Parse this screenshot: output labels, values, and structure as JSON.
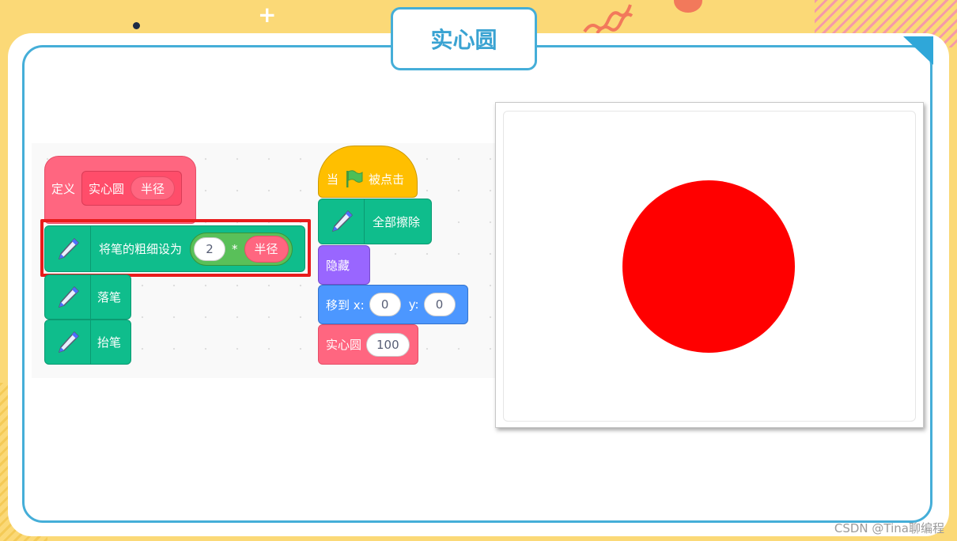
{
  "slide_title": "实心圆",
  "define_block": {
    "label": "定义",
    "name": "实心圆",
    "param": "半径"
  },
  "pen_size_block": {
    "label": "将笔的粗细设为",
    "factor": "2",
    "operator": "*",
    "param": "半径"
  },
  "pen_down_block": {
    "label": "落笔"
  },
  "pen_up_block": {
    "label": "抬笔"
  },
  "hat_block": {
    "prefix": "当",
    "suffix": "被点击"
  },
  "clear_block": {
    "label": "全部擦除"
  },
  "hide_block": {
    "label": "隐藏"
  },
  "goto_block": {
    "label": "移到 x:",
    "x": "0",
    "ylabel": "y:",
    "y": "0"
  },
  "call_block": {
    "label": "实心圆",
    "value": "100"
  },
  "watermark": "CSDN @Tina聊编程",
  "colors": {
    "pen": "#0fbd8c",
    "custom": "#ff6680",
    "events": "#ffbf00",
    "looks": "#9966ff",
    "motion": "#4c97ff",
    "circle": "#ff0000"
  }
}
